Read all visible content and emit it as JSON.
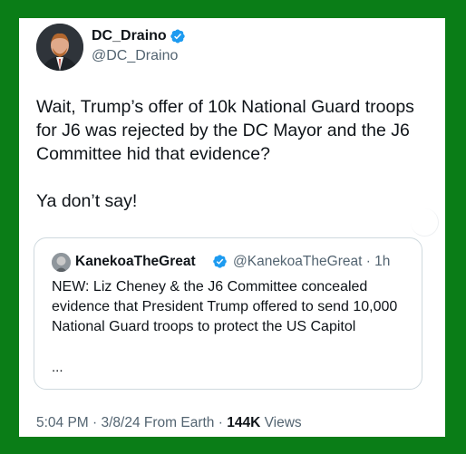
{
  "tweet": {
    "author_name": "DC_Draino",
    "author_handle": "@DC_Draino",
    "text_paragraph_1": "Wait, Trump’s offer of 10k National Guard troops for J6 was rejected by the DC Mayor and the J6 Committee hid that evidence?",
    "text_paragraph_2": "Ya don’t say!",
    "meta": {
      "time": "5:04 PM · 3/8/24 From Earth · ",
      "views_count": "144K",
      "views_label": " Views"
    }
  },
  "quoted_tweet": {
    "author_name": "KanekoaTheGreat",
    "author_handle": "@KanekoaTheGreat · 1h",
    "text": "NEW: Liz Cheney & the J6 Committee concealed evidence that President Trump offered to send 10,000 National Guard troops to protect the US Capitol",
    "truncation": "..."
  },
  "colors": {
    "border_green": "#0a7d17",
    "verified_blue": "#1d9bf0",
    "text": "#0f1419",
    "secondary_text": "#536471"
  },
  "icons": [
    "verified-badge-icon",
    "avatar"
  ]
}
